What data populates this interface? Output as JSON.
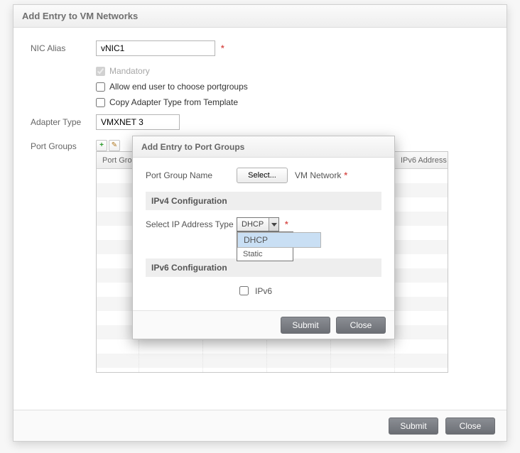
{
  "bgDialog": {
    "title": "Add Entry to VM Networks",
    "nicAliasLabel": "NIC Alias",
    "nicAliasValue": "vNIC1",
    "mandatoryLabel": "Mandatory",
    "allowEndUserLabel": "Allow end user to choose portgroups",
    "copyAdapterLabel": "Copy Adapter Type from Template",
    "adapterTypeLabel": "Adapter Type",
    "adapterTypeValue": "VMXNET 3",
    "portGroupsLabel": "Port Groups",
    "gridHeaders": [
      "Port Group Name",
      "",
      "",
      "",
      "",
      "IPv6 Address"
    ],
    "submit": "Submit",
    "close": "Close"
  },
  "modal": {
    "title": "Add Entry to Port Groups",
    "pgNameLabel": "Port Group Name",
    "selectBtn": "Select...",
    "pgSelected": "VM Network",
    "ipv4Section": "IPv4 Configuration",
    "ipTypeLabel": "Select IP Address Type",
    "ipTypeValue": "DHCP",
    "ipTypeOptions": [
      "DHCP",
      "Static"
    ],
    "ipv6Section": "IPv6 Configuration",
    "ipv6CheckLabel": "IPv6",
    "submit": "Submit",
    "close": "Close"
  }
}
